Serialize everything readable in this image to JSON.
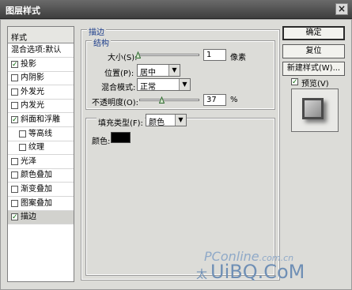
{
  "window": {
    "title": "图层样式",
    "close_glyph": "×"
  },
  "left_panel": {
    "header": "样式",
    "items": [
      {
        "label": "混合选项:默认",
        "checkbox": false,
        "checked": false,
        "indent": false,
        "selected": false
      },
      {
        "label": "投影",
        "checkbox": true,
        "checked": true,
        "indent": false,
        "selected": false
      },
      {
        "label": "内阴影",
        "checkbox": true,
        "checked": false,
        "indent": false,
        "selected": false
      },
      {
        "label": "外发光",
        "checkbox": true,
        "checked": false,
        "indent": false,
        "selected": false
      },
      {
        "label": "内发光",
        "checkbox": true,
        "checked": false,
        "indent": false,
        "selected": false
      },
      {
        "label": "斜面和浮雕",
        "checkbox": true,
        "checked": true,
        "indent": false,
        "selected": false
      },
      {
        "label": "等高线",
        "checkbox": true,
        "checked": false,
        "indent": true,
        "selected": false
      },
      {
        "label": "纹理",
        "checkbox": true,
        "checked": false,
        "indent": true,
        "selected": false
      },
      {
        "label": "光泽",
        "checkbox": true,
        "checked": false,
        "indent": false,
        "selected": false
      },
      {
        "label": "颜色叠加",
        "checkbox": true,
        "checked": false,
        "indent": false,
        "selected": false
      },
      {
        "label": "渐变叠加",
        "checkbox": true,
        "checked": false,
        "indent": false,
        "selected": false
      },
      {
        "label": "图案叠加",
        "checkbox": true,
        "checked": false,
        "indent": false,
        "selected": false
      },
      {
        "label": "描边",
        "checkbox": true,
        "checked": true,
        "indent": false,
        "selected": true
      }
    ]
  },
  "stroke": {
    "section_title": "描边",
    "structure_title": "结构",
    "size_label": "大小(S):",
    "size_value": "1",
    "size_unit": "像素",
    "size_slider_fraction": 0.0,
    "position_label": "位置(P):",
    "position_value": "居中",
    "blend_label": "混合模式:",
    "blend_value": "正常",
    "opacity_label": "不透明度(O):",
    "opacity_value": "37",
    "opacity_unit": "%",
    "opacity_slider_fraction": 0.37,
    "fill_type_label": "填充类型(F):",
    "fill_type_value": "颜色",
    "color_label": "颜色:",
    "color_value": "#000000"
  },
  "buttons": {
    "ok": "确定",
    "reset": "复位",
    "new_style": "新建样式(W)...",
    "preview_label": "预览(V)",
    "preview_checked": true
  },
  "watermark": {
    "line1": "PConline",
    "line1_suffix": ".com.cn",
    "line2": "UiBQ.CoM",
    "line2_prefix": "太"
  },
  "icons": {
    "close": "close-icon",
    "checkmark": "checkmark-icon",
    "dropdown": "chevron-down-icon",
    "slider_thumb": "slider-thumb-icon"
  }
}
